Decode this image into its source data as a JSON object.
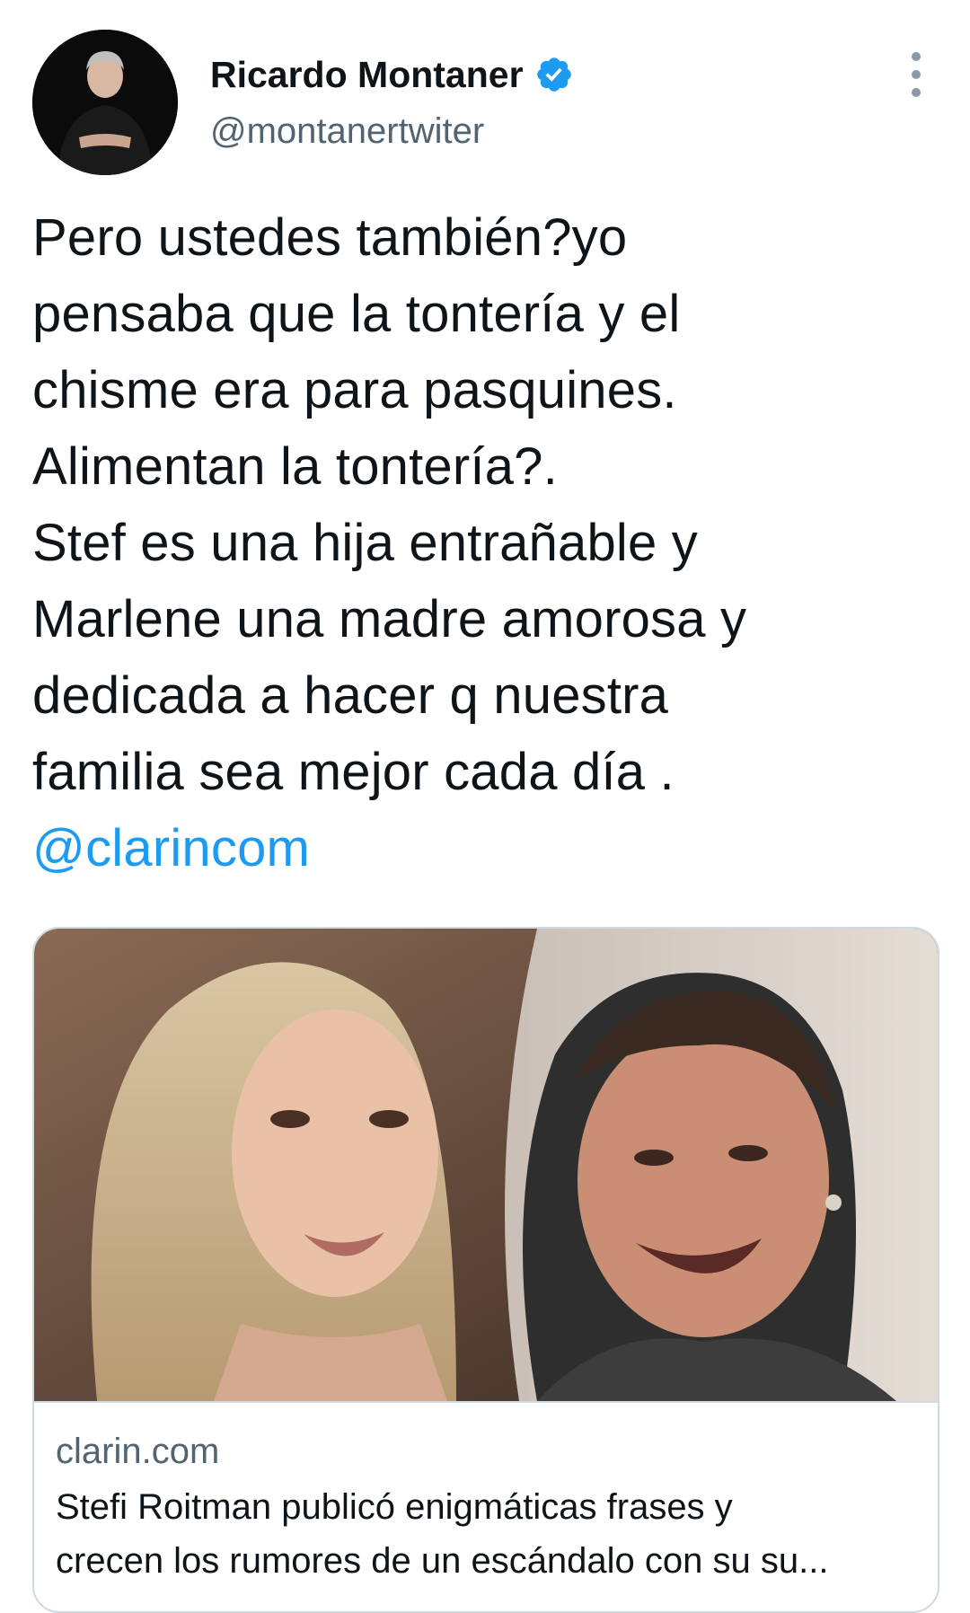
{
  "author": {
    "display_name": "Ricardo Montaner",
    "handle": "@montanertwiter",
    "verified": true
  },
  "tweet": {
    "text_lines": [
      "Pero ustedes también?yo",
      "pensaba que la tontería y el",
      "chisme era para pasquines.",
      "Alimentan la tontería?.",
      "Stef es una hija entrañable y",
      "Marlene una madre amorosa y",
      "dedicada a hacer q nuestra",
      "familia sea mejor cada día ."
    ],
    "mention": "@clarincom"
  },
  "card": {
    "domain": "clarin.com",
    "title_lines": [
      "Stefi Roitman publicó enigmáticas frases y",
      "crecen los rumores de un escándalo con su su..."
    ]
  },
  "icons": {
    "verified_badge": "verified-check-icon",
    "more_options": "more-vertical-icon"
  },
  "colors": {
    "text_primary": "#0f1419",
    "text_secondary": "#536471",
    "link": "#1d9bf0",
    "verified": "#1d9bf0",
    "border": "#cfd9de"
  }
}
